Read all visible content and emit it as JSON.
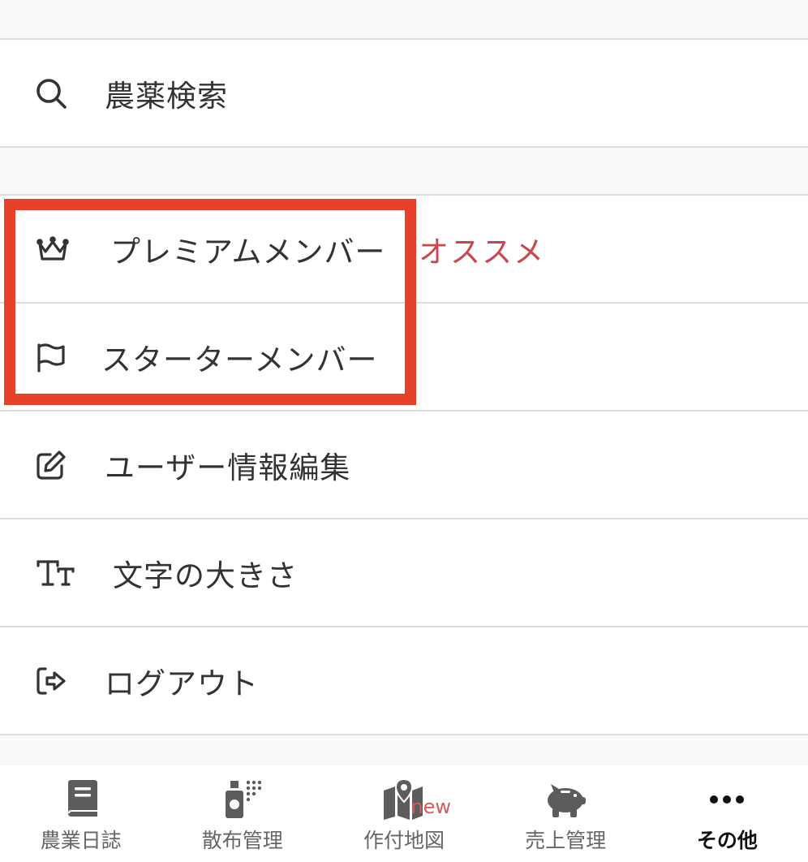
{
  "menu": {
    "pesticide_search": {
      "label": "農薬検索",
      "icon": "search-icon"
    },
    "premium_member": {
      "label": "プレミアムメンバー",
      "badge": "オススメ",
      "icon": "crown-icon"
    },
    "starter_member": {
      "label": "スターターメンバー",
      "icon": "flag-icon"
    },
    "edit_user_info": {
      "label": "ユーザー情報編集",
      "icon": "edit-icon"
    },
    "font_size": {
      "label": "文字の大きさ",
      "icon": "text-size-icon"
    },
    "logout": {
      "label": "ログアウト",
      "icon": "logout-icon"
    }
  },
  "tabs": [
    {
      "label": "農業日誌",
      "icon": "book-icon"
    },
    {
      "label": "散布管理",
      "icon": "sprayer-icon"
    },
    {
      "label": "作付地図",
      "icon": "map-icon",
      "badge": "new"
    },
    {
      "label": "売上管理",
      "icon": "piggy-bank-icon"
    },
    {
      "label": "その他",
      "icon": "more-icon",
      "active": true
    }
  ],
  "colors": {
    "highlight_border": "#e8412a",
    "badge_text": "#c9474e",
    "new_badge": "#d65a5a",
    "icon_gray": "#5c5c5c"
  }
}
